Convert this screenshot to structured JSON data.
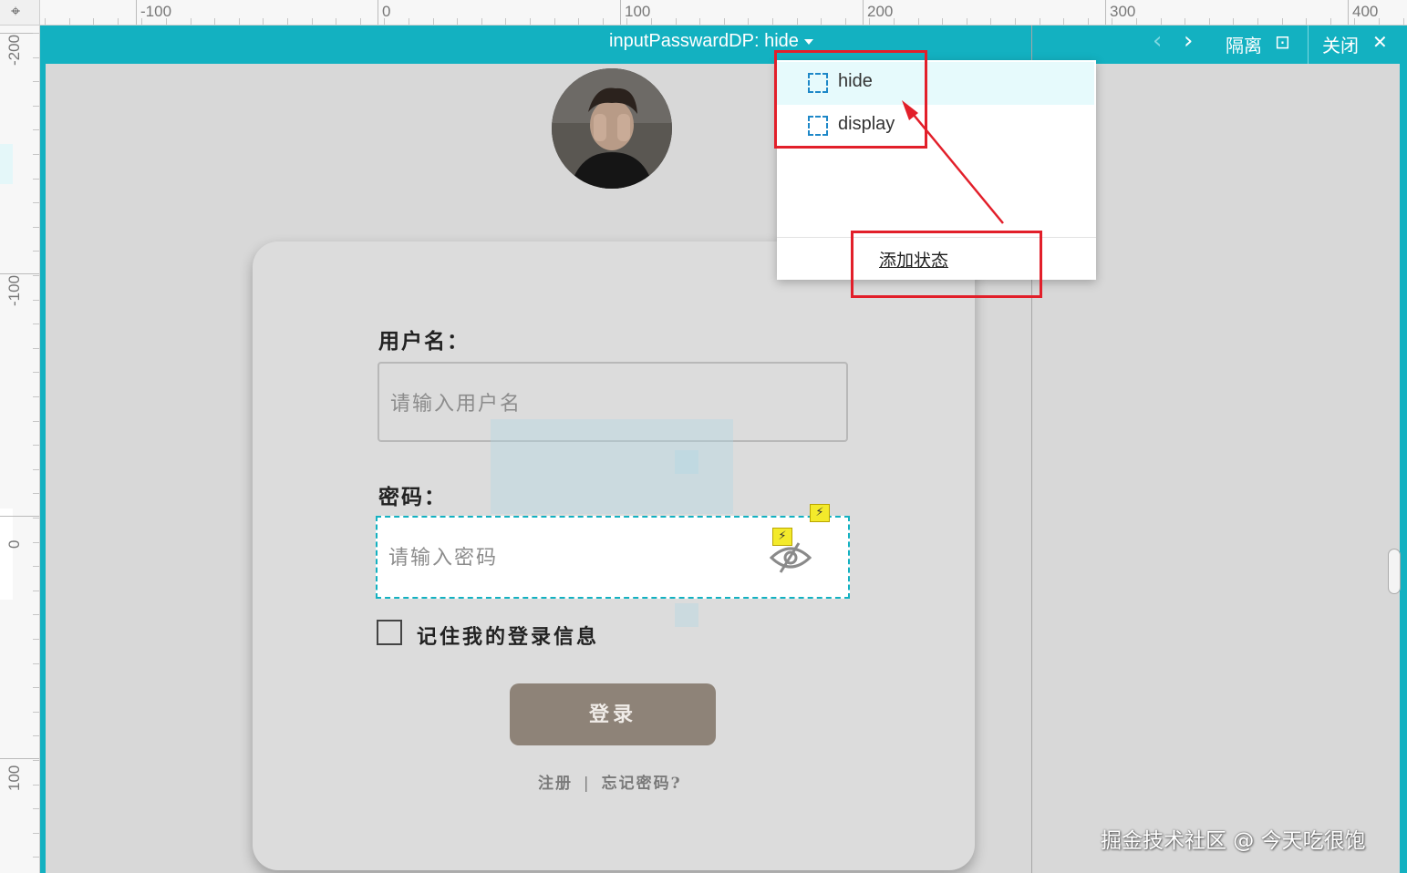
{
  "ruler": {
    "corner_icon": "⌖",
    "top_labels": [
      "-100",
      "0",
      "100",
      "200",
      "300",
      "400"
    ],
    "left_labels": [
      "-200",
      "-100",
      "0",
      "100"
    ]
  },
  "header": {
    "state_title": "inputPasswardDP: hide",
    "prev_icon": "‹",
    "next_icon": "›",
    "isolate_label": "隔离",
    "isolate_icon": "⊡",
    "close_label": "关闭",
    "close_icon": "✕"
  },
  "form": {
    "username_label": "用户名：",
    "username_placeholder": "请输入用户名",
    "password_label": "密码：",
    "password_placeholder": "请输入密码",
    "remember_label": "记住我的登录信息",
    "login_button": "登录",
    "register_link": "注册",
    "link_divider": "|",
    "forgot_link": "忘记密码?",
    "eye_icon": "eye-off-icon",
    "interaction_icon": "⚡"
  },
  "dropdown": {
    "items": [
      {
        "label": "hide",
        "selected": true
      },
      {
        "label": "display",
        "selected": false
      }
    ],
    "add_state": "添加状态"
  },
  "watermark": "掘金技术社区 @ 今天吃很饱",
  "colors": {
    "accent": "#13b1c1",
    "annotation": "#e21f2a",
    "button": "#8e8378",
    "selected_row": "#e6fafc"
  }
}
